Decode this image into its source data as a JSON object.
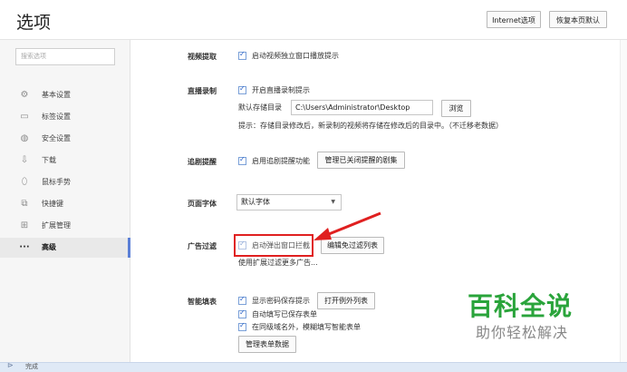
{
  "header": {
    "title": "选项",
    "buttons": {
      "internet": "Internet选项",
      "reset": "恢复本页默认"
    }
  },
  "sidebar": {
    "search_placeholder": "搜索选项",
    "items": [
      {
        "icon": "gear-icon",
        "label": "基本设置"
      },
      {
        "icon": "tab-icon",
        "label": "标签设置"
      },
      {
        "icon": "shield-icon",
        "label": "安全设置"
      },
      {
        "icon": "download-icon",
        "label": "下载"
      },
      {
        "icon": "mouse-icon",
        "label": "鼠标手势"
      },
      {
        "icon": "shortcut-icon",
        "label": "快捷键"
      },
      {
        "icon": "extensions-icon",
        "label": "扩展管理"
      },
      {
        "icon": "more-icon",
        "label": "高级"
      }
    ],
    "active_index": 7
  },
  "sections": {
    "video": {
      "label": "视频提取",
      "checkbox": "启动视频独立窗口播放提示"
    },
    "live": {
      "label": "直播录制",
      "checkbox": "开启直播录制提示",
      "dir_label": "默认存储目录",
      "dir_value": "C:\\Users\\Administrator\\Desktop",
      "browse": "浏览",
      "hint": "提示：存储目录修改后，新录制的视频将存储在修改后的目录中。（不迁移老数据）"
    },
    "drama": {
      "label": "追剧提醒",
      "checkbox": "启用追剧提醒功能",
      "button": "管理已关闭提醒的剧集"
    },
    "font": {
      "label": "页面字体",
      "selected": "默认字体"
    },
    "adblock": {
      "label": "广告过滤",
      "checkbox": "启动弹出窗口拦截",
      "button": "编辑免过滤列表",
      "note": "使用扩展过滤更多广告..."
    },
    "autofill": {
      "label": "智能填表",
      "checkbox1": "显示密码保存提示",
      "button1": "打开例外列表",
      "checkbox2": "自动填写已保存表单",
      "checkbox3": "在同级域名外，模糊填写智能表单",
      "button2": "管理表单数据"
    }
  },
  "status": {
    "text": "完成"
  },
  "watermark": {
    "title": "百科全说",
    "subtitle": "助你轻松解决"
  },
  "colors": {
    "accent": "#5b7fd6",
    "highlight": "#e02020",
    "watermark": "#2aa43b"
  }
}
